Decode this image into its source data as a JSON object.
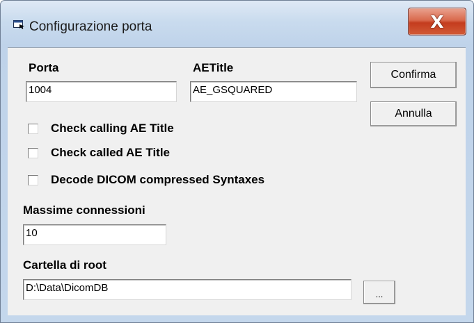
{
  "window": {
    "title": "Configurazione porta",
    "close_glyph": "X",
    "icon": "window-app-icon"
  },
  "fields": {
    "porta": {
      "label": "Porta",
      "value": "1004"
    },
    "aetitle": {
      "label": "AETitle",
      "value": "AE_GSQUARED"
    },
    "max_connections": {
      "label": "Massime connessioni",
      "value": "10"
    },
    "root_folder": {
      "label": "Cartella di root",
      "value": "D:\\Data\\DicomDB"
    }
  },
  "checkboxes": [
    {
      "label": "Check calling AE Title",
      "checked": false
    },
    {
      "label": "Check called AE Title",
      "checked": false
    },
    {
      "label": "Decode DICOM compressed Syntaxes",
      "checked": false
    }
  ],
  "buttons": {
    "confirm": "Confirma",
    "cancel": "Annulla",
    "browse": "..."
  },
  "colors": {
    "close_button": "#c43c1e",
    "frame": "#c4d7ec",
    "client": "#f0f0f0"
  }
}
